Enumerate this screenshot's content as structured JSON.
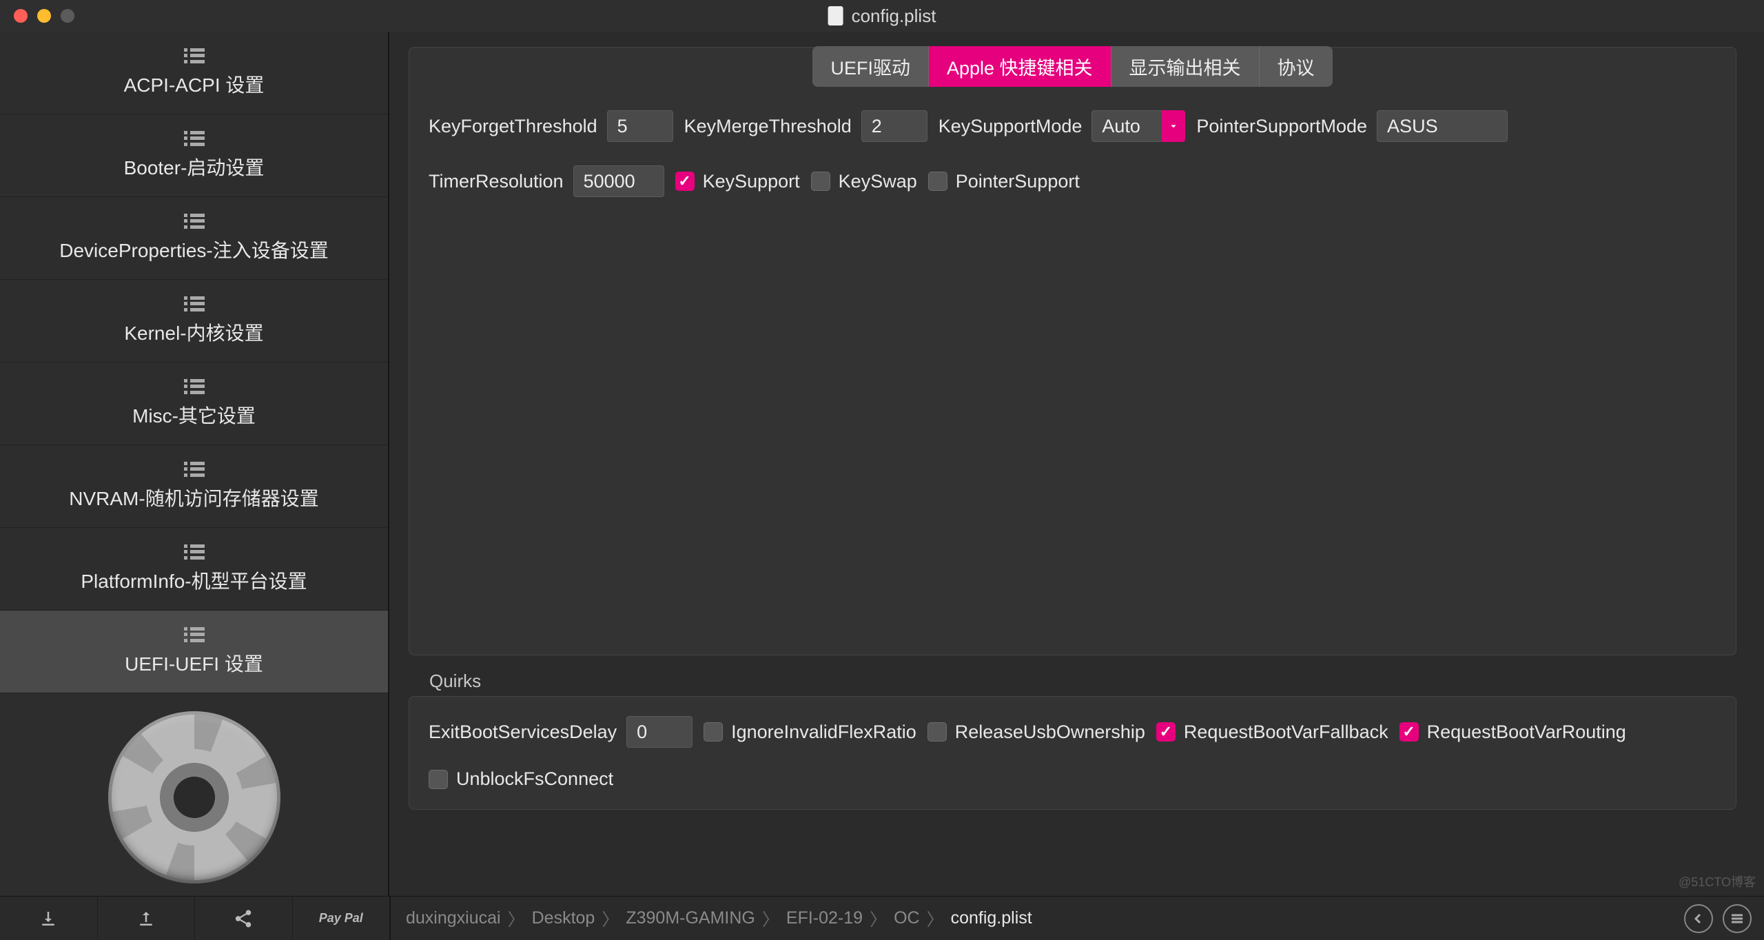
{
  "window": {
    "title": "config.plist"
  },
  "sidebar": {
    "items": [
      {
        "label": "ACPI-ACPI 设置"
      },
      {
        "label": "Booter-启动设置"
      },
      {
        "label": "DeviceProperties-注入设备设置"
      },
      {
        "label": "Kernel-内核设置"
      },
      {
        "label": "Misc-其它设置"
      },
      {
        "label": "NVRAM-随机访问存储器设置"
      },
      {
        "label": "PlatformInfo-机型平台设置"
      },
      {
        "label": "UEFI-UEFI 设置"
      }
    ],
    "activeIndex": 7
  },
  "tabs": {
    "items": [
      "UEFI驱动",
      "Apple 快捷键相关",
      "显示输出相关",
      "协议"
    ],
    "activeIndex": 1
  },
  "appleInput": {
    "keyForgetThreshold": {
      "label": "KeyForgetThreshold",
      "value": "5"
    },
    "keyMergeThreshold": {
      "label": "KeyMergeThreshold",
      "value": "2"
    },
    "keySupportMode": {
      "label": "KeySupportMode",
      "value": "Auto"
    },
    "pointerSupportMode": {
      "label": "PointerSupportMode",
      "value": "ASUS"
    },
    "timerResolution": {
      "label": "TimerResolution",
      "value": "50000"
    },
    "keySupport": {
      "label": "KeySupport",
      "checked": true
    },
    "keySwap": {
      "label": "KeySwap",
      "checked": false
    },
    "pointerSupport": {
      "label": "PointerSupport",
      "checked": false
    }
  },
  "quirks": {
    "title": "Quirks",
    "exitBootServicesDelay": {
      "label": "ExitBootServicesDelay",
      "value": "0"
    },
    "ignoreInvalidFlexRatio": {
      "label": "IgnoreInvalidFlexRatio",
      "checked": false
    },
    "releaseUsbOwnership": {
      "label": "ReleaseUsbOwnership",
      "checked": false
    },
    "requestBootVarFallback": {
      "label": "RequestBootVarFallback",
      "checked": true
    },
    "requestBootVarRouting": {
      "label": "RequestBootVarRouting",
      "checked": true
    },
    "unblockFsConnect": {
      "label": "UnblockFsConnect",
      "checked": false
    }
  },
  "breadcrumbs": [
    "duxingxiucai",
    "Desktop",
    "Z390M-GAMING",
    "EFI-02-19",
    "OC",
    "config.plist"
  ],
  "bottomButtons": {
    "paypal": "Pay\nPal"
  },
  "watermark": "@51CTO博客"
}
